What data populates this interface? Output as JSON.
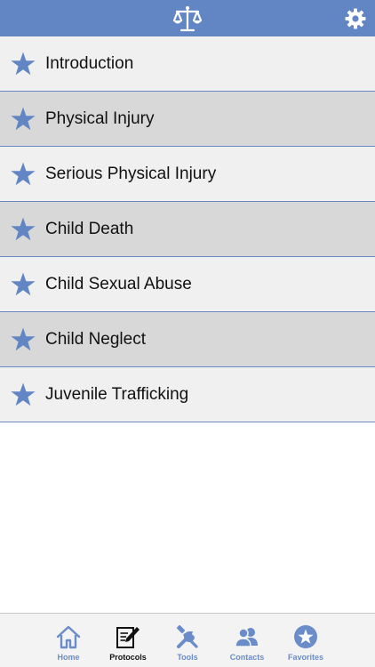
{
  "header": {
    "logo_icon": "scales-of-justice-icon",
    "settings_icon": "gear-icon"
  },
  "colors": {
    "accent": "#6286c4",
    "row_light": "#f0f0f0",
    "row_dark": "#d8d8d8",
    "divider": "#6c8bc6"
  },
  "protocols": [
    {
      "label": "Introduction",
      "icon": "star-icon"
    },
    {
      "label": "Physical Injury",
      "icon": "star-icon"
    },
    {
      "label": "Serious Physical Injury",
      "icon": "star-icon"
    },
    {
      "label": "Child Death",
      "icon": "star-icon"
    },
    {
      "label": "Child Sexual Abuse",
      "icon": "star-icon"
    },
    {
      "label": "Child Neglect",
      "icon": "star-icon"
    },
    {
      "label": "Juvenile Trafficking",
      "icon": "star-icon"
    }
  ],
  "tabbar": {
    "selected": "Protocols",
    "tabs": [
      {
        "label": "Home",
        "icon": "home-icon"
      },
      {
        "label": "Protocols",
        "icon": "document-pencil-icon"
      },
      {
        "label": "Tools",
        "icon": "tools-icon"
      },
      {
        "label": "Contacts",
        "icon": "contacts-icon"
      },
      {
        "label": "Favorites",
        "icon": "favorites-star-icon"
      }
    ]
  }
}
